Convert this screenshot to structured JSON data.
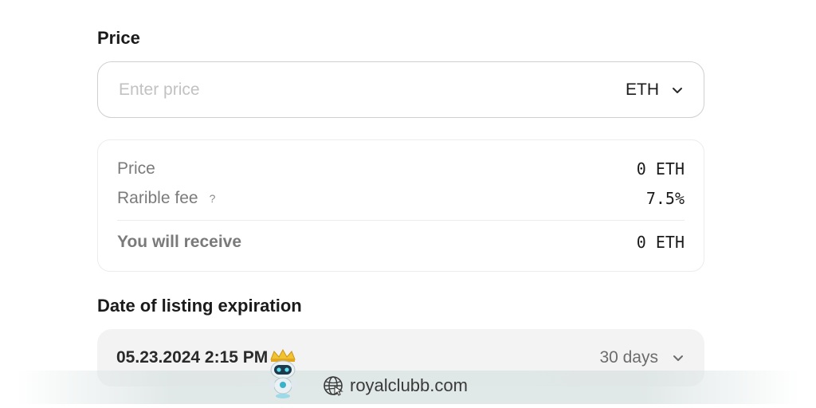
{
  "price_section": {
    "title": "Price",
    "input_placeholder": "Enter price",
    "currency": "ETH"
  },
  "summary": {
    "price_label": "Price",
    "price_value": "0 ETH",
    "fee_label": "Rarible fee",
    "fee_help": "?",
    "fee_value": "7.5%",
    "receive_label": "You will receive",
    "receive_value": "0 ETH"
  },
  "expiration": {
    "title": "Date of listing expiration",
    "date_value": "05.23.2024 2:15 PM",
    "duration": "30 days"
  },
  "watermark": {
    "text": "royalclubb.com",
    "icon": "globe-icon",
    "logo": "robot-mascot-logo"
  }
}
